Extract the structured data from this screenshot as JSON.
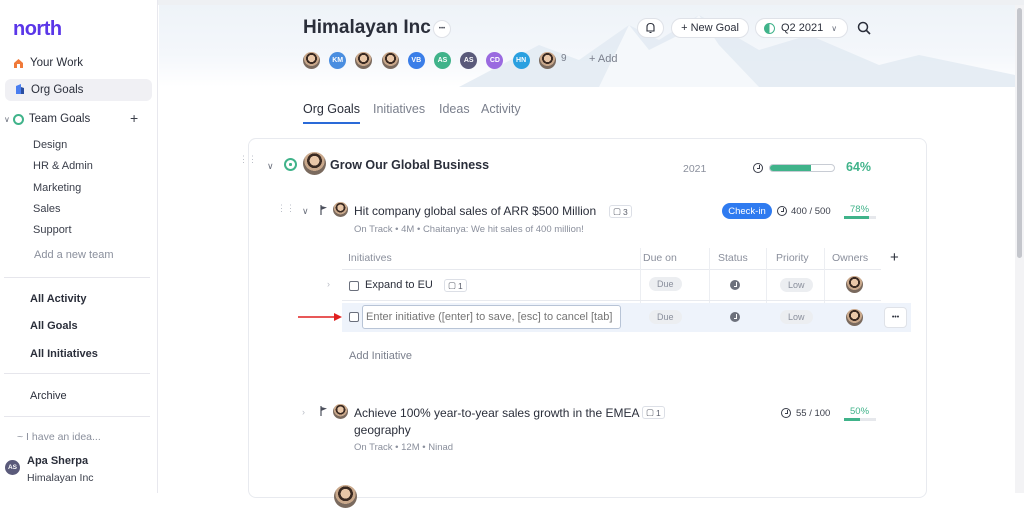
{
  "app": {
    "logo": "north"
  },
  "sidebar": {
    "your_work": "Your Work",
    "org_goals": "Org Goals",
    "team_goals": "Team Goals",
    "teams": [
      "Design",
      "HR & Admin",
      "Marketing",
      "Sales",
      "Support"
    ],
    "add_team": "Add a new team",
    "all_activity": "All Activity",
    "all_goals": "All Goals",
    "all_initiatives": "All Initiatives",
    "archive": "Archive",
    "idea": "~ I have an idea...",
    "user": {
      "initials": "AS",
      "name": "Apa Sherpa",
      "org": "Himalayan Inc"
    }
  },
  "header": {
    "title": "Himalayan Inc",
    "more": "•••",
    "members": [
      {
        "initials": ""
      },
      {
        "initials": "KM",
        "color": "#4a8ee0"
      },
      {
        "initials": ""
      },
      {
        "initials": ""
      },
      {
        "initials": "VB",
        "color": "#3a7ee8"
      },
      {
        "initials": "AS",
        "color": "#40b38a"
      },
      {
        "initials": "AS",
        "color": "#5a5a7a"
      },
      {
        "initials": "CD",
        "color": "#9a6ae0"
      },
      {
        "initials": "HN",
        "color": "#2aa0e0"
      },
      {
        "initials": ""
      }
    ],
    "member_count": "9",
    "add_member": "+ Add",
    "new_goal": "+ New Goal",
    "quarter": "Q2 2021"
  },
  "tabs": [
    "Org Goals",
    "Initiatives",
    "Ideas",
    "Activity"
  ],
  "goal": {
    "title": "Grow Our Global Business",
    "year": "2021",
    "progress_pct": "64%",
    "progress": 0.64
  },
  "kr1": {
    "title": "Hit company global sales of ARR $500 Million",
    "comments": "3",
    "meta": "On Track  •  4M  •  Chaitanya: We hit sales of 400 million!",
    "checkin": "Check-in",
    "value": "400 / 500",
    "pct": "78%",
    "progress": 0.78
  },
  "table": {
    "columns": [
      "Initiatives",
      "Due on",
      "Status",
      "Priority",
      "Owners"
    ],
    "rows": [
      {
        "title": "Expand to EU",
        "comments": "1",
        "due": "Due",
        "priority": "Low"
      }
    ],
    "new_row": {
      "placeholder": "Enter initiative ([enter] to save, [esc] to cancel [tab]",
      "due": "Due",
      "priority": "Low"
    },
    "add": "Add Initiative"
  },
  "kr2": {
    "title_line1": "Achieve 100% year-to-year sales growth in the EMEA",
    "title_line2": "geography",
    "comments": "1",
    "meta": "On Track  •  12M  •  Ninad",
    "value": "55 / 100",
    "pct": "50%",
    "progress": 0.5
  },
  "colors": {
    "accent": "#5a36e8",
    "green": "#40b38a",
    "checkin": "#2f7bf0",
    "arrow": "#e02020"
  }
}
